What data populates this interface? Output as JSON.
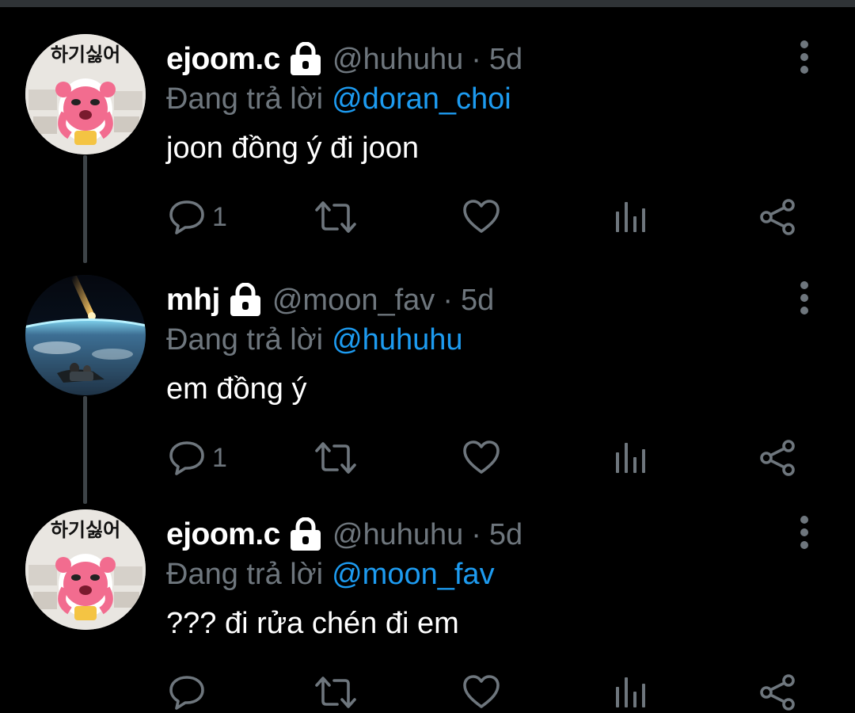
{
  "tweets": [
    {
      "display_name": "ejoom.c",
      "handle": "@huhuhu",
      "separator": "·",
      "time": "5d",
      "reply_prefix": "Đang trả lời",
      "reply_to": "@doran_choi",
      "text": "joon đồng ý đi joon",
      "reply_count": "1",
      "avatar_text": "하기싫어",
      "avatar": "pink-cartoon-character",
      "locked": true
    },
    {
      "display_name": "mhj",
      "handle": "@moon_fav",
      "separator": "·",
      "time": "5d",
      "reply_prefix": "Đang trả lời",
      "reply_to": "@huhuhu",
      "text": "em đồng ý",
      "reply_count": "1",
      "avatar": "meteor-over-earth",
      "locked": true
    },
    {
      "display_name": "ejoom.c",
      "handle": "@huhuhu",
      "separator": "·",
      "time": "5d",
      "reply_prefix": "Đang trả lời",
      "reply_to": "@moon_fav",
      "text": "??? đi rửa chén đi em",
      "reply_count": "",
      "avatar_text": "하기싫어",
      "avatar": "pink-cartoon-character",
      "locked": true
    }
  ],
  "icons": {
    "reply": "reply-icon",
    "retweet": "retweet-icon",
    "like": "heart-icon",
    "stats": "stats-icon",
    "share": "share-icon",
    "more": "more-vertical-icon",
    "lock": "lock-icon"
  },
  "colors": {
    "background": "#000000",
    "text": "#ffffff",
    "muted": "#6e767d",
    "link": "#1d9bf0",
    "thread_line": "#3d4347",
    "icon": "#6e767d"
  }
}
